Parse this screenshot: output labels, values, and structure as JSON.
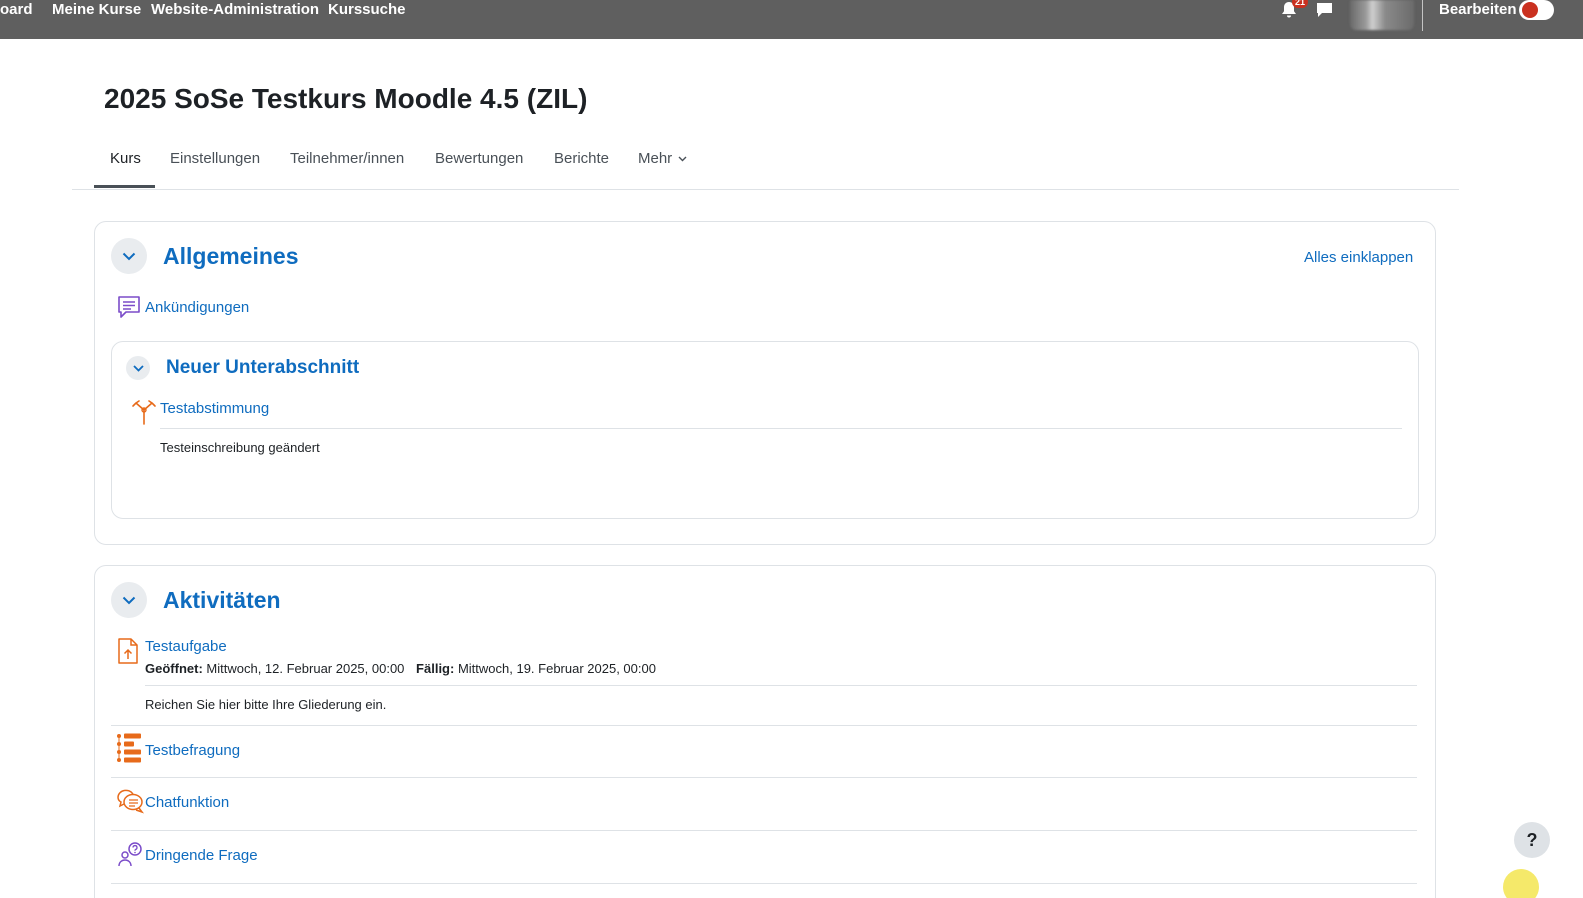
{
  "navbar": {
    "links": [
      "oard",
      "Meine Kurse",
      "Website-Administration",
      "Kurssuche"
    ],
    "notification_count": "21",
    "edit_label": "Bearbeiten"
  },
  "page": {
    "title": "2025 SoSe Testkurs Moodle 4.5 (ZIL)"
  },
  "tabs": [
    "Kurs",
    "Einstellungen",
    "Teilnehmer/innen",
    "Bewertungen",
    "Berichte",
    "Mehr"
  ],
  "sections": {
    "general": {
      "title": "Allgemeines",
      "collapse_all": "Alles einklappen",
      "announcements": "Ankündigungen",
      "subsection": {
        "title": "Neuer Unterabschnitt",
        "activity": "Testabstimmung",
        "description": "Testeinschreibung geändert"
      }
    },
    "activities": {
      "title": "Aktivitäten",
      "assignment": {
        "name": "Testaufgabe",
        "opened_label": "Geöffnet:",
        "opened_value": "Mittwoch, 12. Februar 2025, 00:00",
        "due_label": "Fällig:",
        "due_value": "Mittwoch, 19. Februar 2025, 00:00",
        "description": "Reichen Sie hier bitte Ihre Gliederung ein."
      },
      "survey": "Testbefragung",
      "chat": "Chatfunktion",
      "question": "Dringende Frage"
    }
  },
  "help": "?",
  "colors": {
    "navbar": "#5f5f5f",
    "link": "#0f6cbf",
    "activity_orange": "#e76a1a",
    "activity_purple": "#7b4cc9",
    "toggle_red": "#ca3120"
  }
}
